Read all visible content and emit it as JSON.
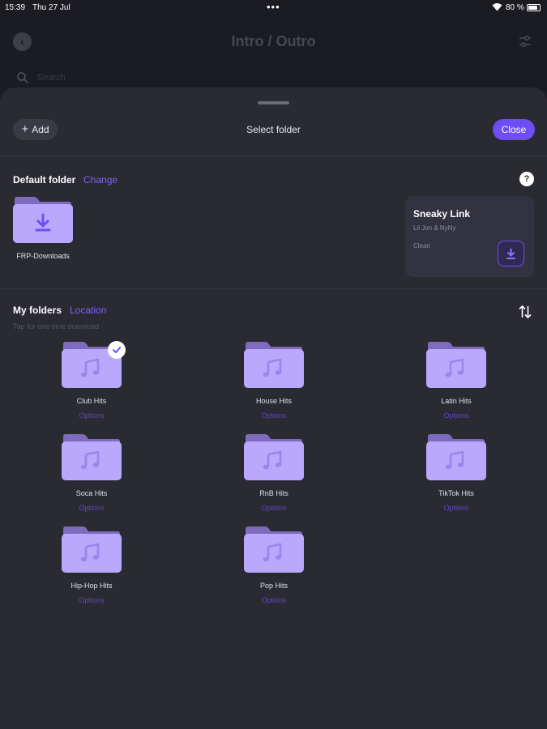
{
  "status_bar": {
    "time": "15:39",
    "date": "Thu 27 Jul",
    "dots": "•••",
    "battery": "80 %"
  },
  "background": {
    "title": "Intro / Outro",
    "search_placeholder": "Search"
  },
  "sheet": {
    "add_label": "Add",
    "title": "Select folder",
    "close_label": "Close"
  },
  "default_folder": {
    "heading": "Default folder",
    "change_link": "Change",
    "help": "?",
    "folder_label": "FRP-Downloads"
  },
  "song_card": {
    "title": "Sneaky Link",
    "artist": "Lil Jon & NyNy",
    "version": "Clean"
  },
  "my_folders": {
    "heading": "My folders",
    "location_link": "Location",
    "subtitle": "Tap for one-time download",
    "folders": [
      {
        "name": "Club Hits",
        "options": "Options",
        "selected": true
      },
      {
        "name": "House Hits",
        "options": "Options"
      },
      {
        "name": "Latin Hits",
        "options": "Options"
      },
      {
        "name": "Soca Hits",
        "options": "Options"
      },
      {
        "name": "RnB Hits",
        "options": "Options"
      },
      {
        "name": "TikTok Hits",
        "options": "Options"
      },
      {
        "name": "Hip-Hop Hits",
        "options": "Options"
      },
      {
        "name": "Pop Hits",
        "options": "Options"
      }
    ]
  },
  "colors": {
    "accent": "#6d4ef6",
    "folder_front": "#b9a8fb",
    "folder_back": "#7f6bbd",
    "sheet_bg": "#2a2a33",
    "page_bg": "#1b1b22"
  },
  "icons": {
    "back": "chevron-left-icon",
    "filter": "sliders-icon",
    "search": "search-icon",
    "add": "plus-icon",
    "help": "question-icon",
    "download": "download-icon",
    "music": "music-note-icon",
    "sort": "sort-arrows-icon",
    "check": "check-icon"
  }
}
